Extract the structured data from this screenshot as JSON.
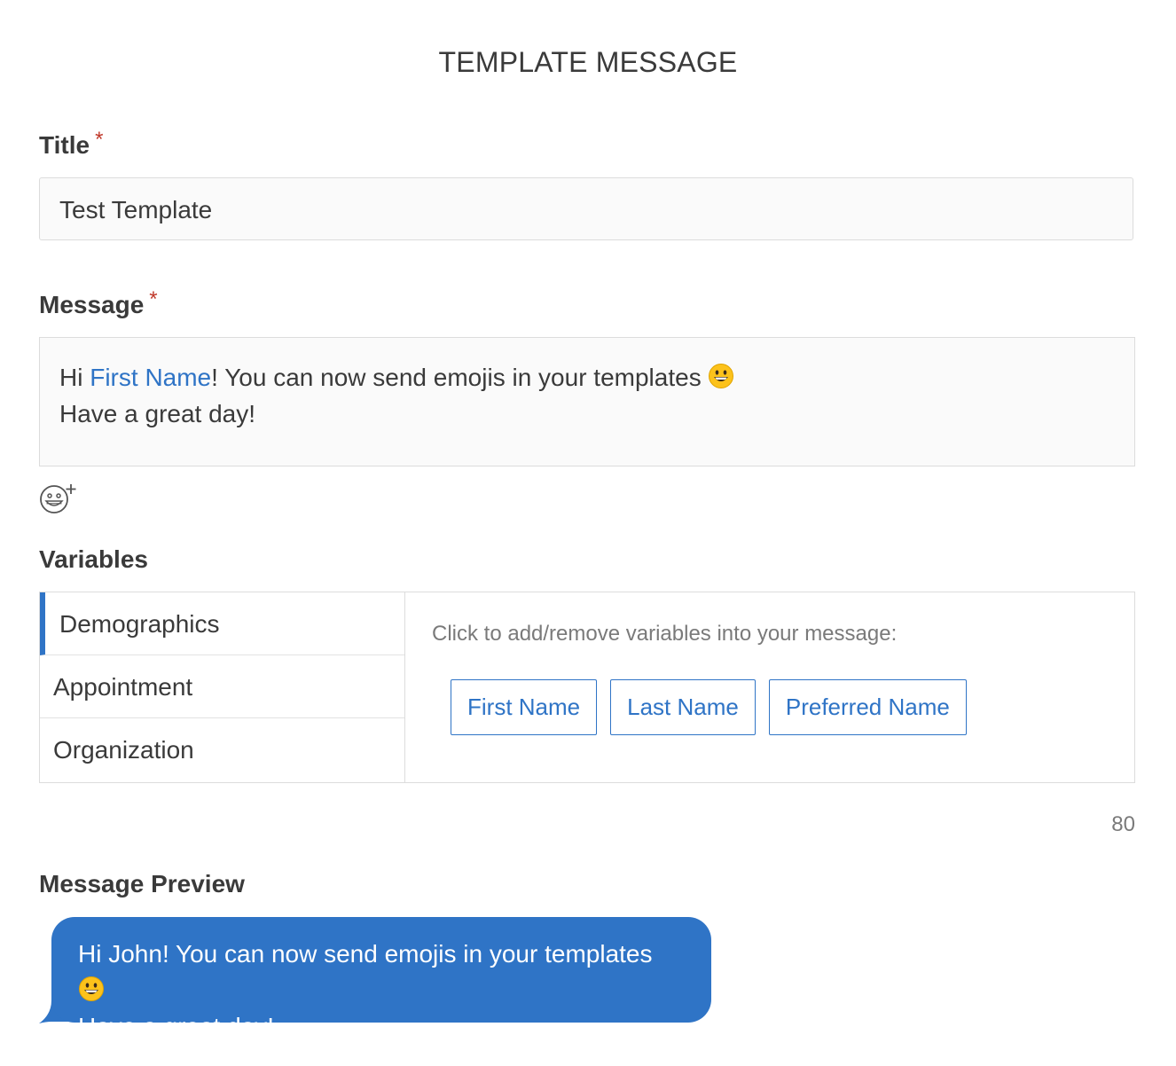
{
  "page": {
    "title": "TEMPLATE MESSAGE"
  },
  "title_field": {
    "label": "Title",
    "required_mark": "*",
    "value": "Test Template"
  },
  "message_field": {
    "label": "Message",
    "required_mark": "*",
    "line1_prefix": "Hi ",
    "line1_variable": "First Name",
    "line1_suffix": "! You can now send emojis in your templates",
    "line2": "Have a great day!",
    "emoji": "grinning-face"
  },
  "emoji_picker": {
    "icon": "emoji-add-icon"
  },
  "variables": {
    "label": "Variables",
    "tabs": [
      {
        "label": "Demographics",
        "active": true
      },
      {
        "label": "Appointment",
        "active": false
      },
      {
        "label": "Organization",
        "active": false
      }
    ],
    "instruction": "Click to add/remove variables into your message:",
    "buttons": [
      {
        "label": "First Name"
      },
      {
        "label": "Last Name"
      },
      {
        "label": "Preferred Name"
      }
    ]
  },
  "char_count": "80",
  "preview": {
    "label": "Message Preview",
    "line1": "Hi John! You can now send emojis in your templates",
    "line2": "Have a great day!",
    "emoji": "grinning-face"
  },
  "colors": {
    "accent": "#2f74c6",
    "required": "#c0392b",
    "text": "#3a3a3a",
    "muted": "#7a7a7a",
    "border": "#dcdcdc",
    "input_bg": "#fafafa"
  }
}
